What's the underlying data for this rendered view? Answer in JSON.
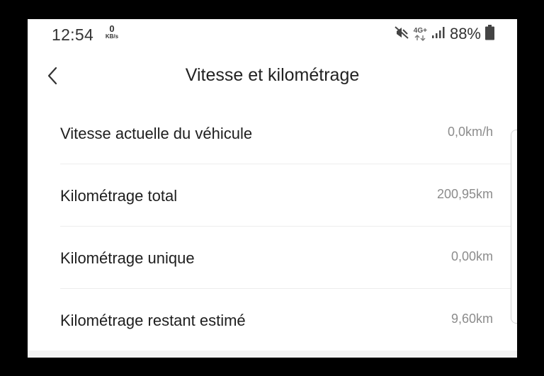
{
  "status_bar": {
    "time": "12:54",
    "net_speed_value": "0",
    "net_speed_unit": "KB/s",
    "network_type": "4G+",
    "battery_percent": "88%",
    "icons": [
      "mute-icon",
      "network-4g-icon",
      "signal-icon",
      "battery-icon"
    ]
  },
  "header": {
    "title": "Vitesse et kilométrage",
    "back_icon": "chevron-left-icon"
  },
  "rows": [
    {
      "label": "Vitesse actuelle du véhicule",
      "value": "0,0km/h"
    },
    {
      "label": "Kilométrage total",
      "value": "200,95km"
    },
    {
      "label": "Kilométrage unique",
      "value": "0,00km"
    },
    {
      "label": "Kilométrage restant estimé",
      "value": "9,60km"
    }
  ],
  "colors": {
    "background": "#ffffff",
    "frame": "#000000",
    "label_text": "#1e1e1e",
    "value_text": "#8c8c8c",
    "divider": "#ededed"
  }
}
